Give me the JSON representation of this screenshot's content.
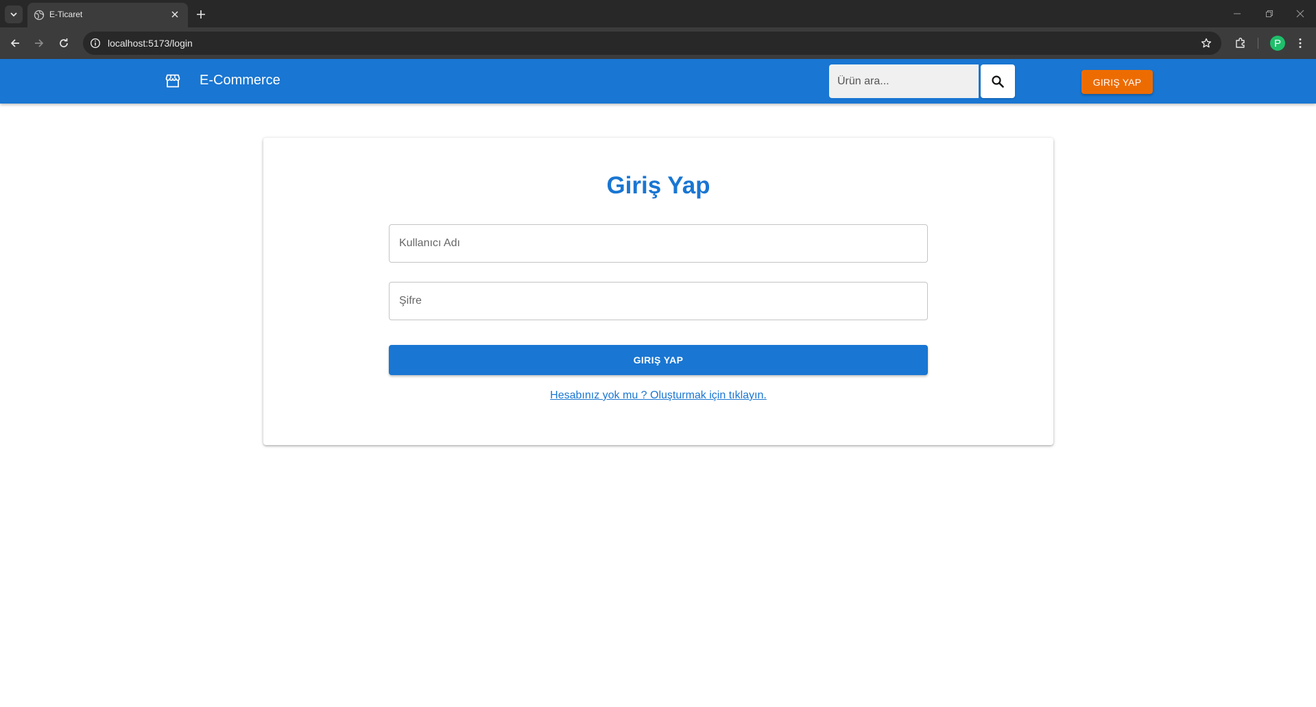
{
  "browser": {
    "tab_title": "E-Ticaret",
    "url": "localhost:5173/login",
    "profile_initial": "P"
  },
  "header": {
    "brand": "E-Commerce",
    "search_placeholder": "Ürün ara...",
    "login_button": "GIRIŞ YAP",
    "primary_color": "#1976d2",
    "login_button_color": "#ed6c02"
  },
  "login": {
    "title": "Giriş Yap",
    "username_label": "Kullanıcı Adı",
    "password_label": "Şifre",
    "submit_label": "GIRIŞ YAP",
    "register_link": "Hesabınız yok mu ? Oluşturmak için tıklayın."
  },
  "icons": {
    "store": "storefront-icon",
    "search": "search-icon"
  }
}
